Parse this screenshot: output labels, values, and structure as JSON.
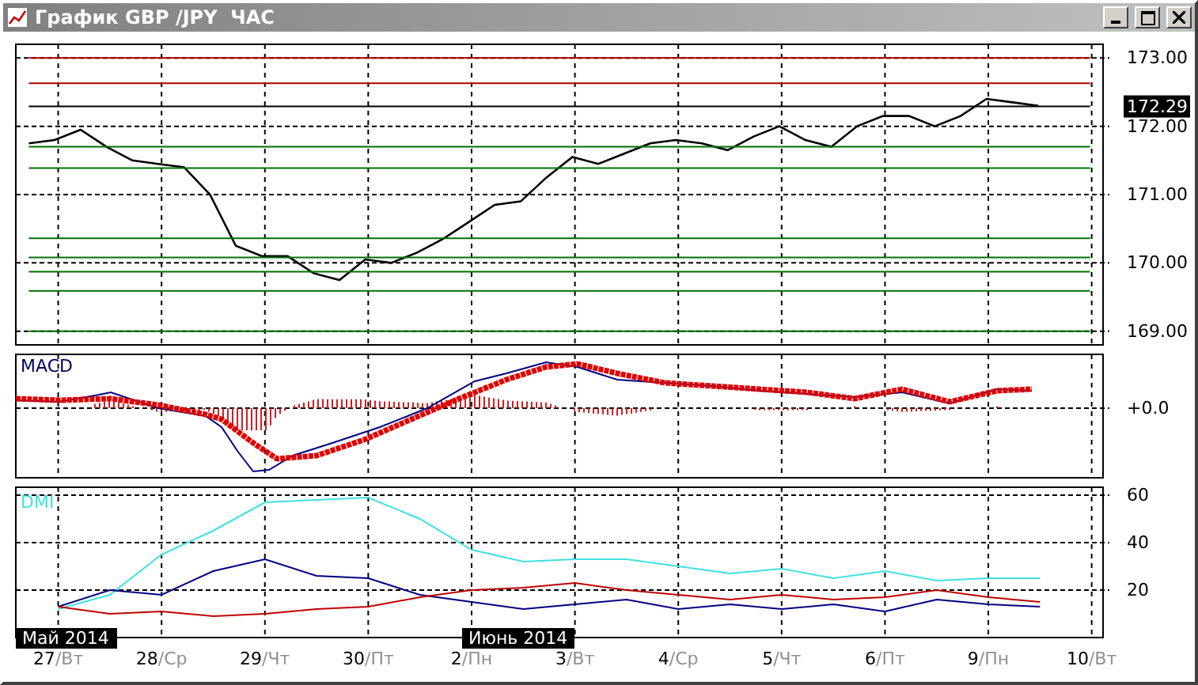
{
  "window": {
    "title": "График GBP /JPY  ЧАС",
    "buttons": [
      {
        "kind": "minimize"
      },
      {
        "kind": "maximize"
      },
      {
        "kind": "close"
      }
    ]
  },
  "price_panel": {
    "last_price": "172.29",
    "chart_data": {
      "type": "line",
      "categories": [
        null,
        null,
        null,
        null,
        null,
        null,
        null,
        null,
        null,
        null,
        null,
        null,
        null,
        null,
        null,
        null,
        null,
        null,
        null,
        null,
        null,
        null,
        null,
        null,
        null,
        null,
        null,
        null,
        null,
        null,
        null,
        null,
        null,
        null,
        null,
        null,
        null,
        null,
        null,
        null,
        null,
        null
      ],
      "series": [
        {
          "color": "#000000",
          "values": [
            171.75,
            171.8,
            171.95,
            171.7,
            171.5,
            171.45,
            171.4,
            171.0,
            170.25,
            170.1,
            170.1,
            169.85,
            169.75,
            170.05,
            170.0,
            170.15,
            170.35,
            170.6,
            170.85,
            170.9,
            171.25,
            171.55,
            171.45,
            171.6,
            171.75,
            171.8,
            171.75,
            171.65,
            171.85,
            172.0,
            171.8,
            171.7,
            172.0,
            172.15,
            172.15,
            172.0,
            172.15,
            172.4,
            172.35,
            172.3,
            null,
            null
          ]
        },
        {
          "color": "#b00000",
          "values": [
            173,
            173,
            173,
            173,
            173,
            173,
            173,
            173,
            173,
            173,
            173,
            173,
            173,
            173,
            173,
            173,
            173,
            173,
            173,
            173,
            173,
            173,
            173,
            173,
            173,
            173,
            173,
            173,
            173,
            173,
            173,
            173,
            173,
            173,
            173,
            173,
            173,
            173,
            173,
            173,
            173,
            173
          ]
        },
        {
          "color": "#b00000",
          "values": [
            172.63,
            172.63,
            172.63,
            172.63,
            172.63,
            172.63,
            172.63,
            172.63,
            172.63,
            172.63,
            172.63,
            172.63,
            172.63,
            172.63,
            172.63,
            172.63,
            172.63,
            172.63,
            172.63,
            172.63,
            172.63,
            172.63,
            172.63,
            172.63,
            172.63,
            172.63,
            172.63,
            172.63,
            172.63,
            172.63,
            172.63,
            172.63,
            172.63,
            172.63,
            172.63,
            172.63,
            172.63,
            172.63,
            172.63,
            172.63,
            172.63,
            172.63
          ]
        },
        {
          "color": "#000000",
          "values": [
            172.29,
            172.29,
            172.29,
            172.29,
            172.29,
            172.29,
            172.29,
            172.29,
            172.29,
            172.29,
            172.29,
            172.29,
            172.29,
            172.29,
            172.29,
            172.29,
            172.29,
            172.29,
            172.29,
            172.29,
            172.29,
            172.29,
            172.29,
            172.29,
            172.29,
            172.29,
            172.29,
            172.29,
            172.29,
            172.29,
            172.29,
            172.29,
            172.29,
            172.29,
            172.29,
            172.29,
            172.29,
            172.29,
            172.29,
            172.29,
            172.29,
            172.29
          ]
        },
        {
          "color": "#007000",
          "values": [
            171.7,
            171.7,
            171.7,
            171.7,
            171.7,
            171.7,
            171.7,
            171.7,
            171.7,
            171.7,
            171.7,
            171.7,
            171.7,
            171.7,
            171.7,
            171.7,
            171.7,
            171.7,
            171.7,
            171.7,
            171.7,
            171.7,
            171.7,
            171.7,
            171.7,
            171.7,
            171.7,
            171.7,
            171.7,
            171.7,
            171.7,
            171.7,
            171.7,
            171.7,
            171.7,
            171.7,
            171.7,
            171.7,
            171.7,
            171.7,
            171.7,
            171.7
          ]
        },
        {
          "color": "#007000",
          "values": [
            171.39,
            171.39,
            171.39,
            171.39,
            171.39,
            171.39,
            171.39,
            171.39,
            171.39,
            171.39,
            171.39,
            171.39,
            171.39,
            171.39,
            171.39,
            171.39,
            171.39,
            171.39,
            171.39,
            171.39,
            171.39,
            171.39,
            171.39,
            171.39,
            171.39,
            171.39,
            171.39,
            171.39,
            171.39,
            171.39,
            171.39,
            171.39,
            171.39,
            171.39,
            171.39,
            171.39,
            171.39,
            171.39,
            171.39,
            171.39,
            171.39,
            171.39
          ]
        },
        {
          "color": "#007000",
          "values": [
            170.36,
            170.36,
            170.36,
            170.36,
            170.36,
            170.36,
            170.36,
            170.36,
            170.36,
            170.36,
            170.36,
            170.36,
            170.36,
            170.36,
            170.36,
            170.36,
            170.36,
            170.36,
            170.36,
            170.36,
            170.36,
            170.36,
            170.36,
            170.36,
            170.36,
            170.36,
            170.36,
            170.36,
            170.36,
            170.36,
            170.36,
            170.36,
            170.36,
            170.36,
            170.36,
            170.36,
            170.36,
            170.36,
            170.36,
            170.36,
            170.36,
            170.36
          ]
        },
        {
          "color": "#007000",
          "values": [
            170.08,
            170.08,
            170.08,
            170.08,
            170.08,
            170.08,
            170.08,
            170.08,
            170.08,
            170.08,
            170.08,
            170.08,
            170.08,
            170.08,
            170.08,
            170.08,
            170.08,
            170.08,
            170.08,
            170.08,
            170.08,
            170.08,
            170.08,
            170.08,
            170.08,
            170.08,
            170.08,
            170.08,
            170.08,
            170.08,
            170.08,
            170.08,
            170.08,
            170.08,
            170.08,
            170.08,
            170.08,
            170.08,
            170.08,
            170.08,
            170.08,
            170.08
          ]
        },
        {
          "color": "#007000",
          "values": [
            169.87,
            169.87,
            169.87,
            169.87,
            169.87,
            169.87,
            169.87,
            169.87,
            169.87,
            169.87,
            169.87,
            169.87,
            169.87,
            169.87,
            169.87,
            169.87,
            169.87,
            169.87,
            169.87,
            169.87,
            169.87,
            169.87,
            169.87,
            169.87,
            169.87,
            169.87,
            169.87,
            169.87,
            169.87,
            169.87,
            169.87,
            169.87,
            169.87,
            169.87,
            169.87,
            169.87,
            169.87,
            169.87,
            169.87,
            169.87,
            169.87,
            169.87
          ]
        },
        {
          "color": "#007000",
          "values": [
            169.59,
            169.59,
            169.59,
            169.59,
            169.59,
            169.59,
            169.59,
            169.59,
            169.59,
            169.59,
            169.59,
            169.59,
            169.59,
            169.59,
            169.59,
            169.59,
            169.59,
            169.59,
            169.59,
            169.59,
            169.59,
            169.59,
            169.59,
            169.59,
            169.59,
            169.59,
            169.59,
            169.59,
            169.59,
            169.59,
            169.59,
            169.59,
            169.59,
            169.59,
            169.59,
            169.59,
            169.59,
            169.59,
            169.59,
            169.59,
            169.59,
            169.59
          ]
        },
        {
          "color": "#007000",
          "values": [
            169,
            169,
            169,
            169,
            169,
            169,
            169,
            169,
            169,
            169,
            169,
            169,
            169,
            169,
            169,
            169,
            169,
            169,
            169,
            169,
            169,
            169,
            169,
            169,
            169,
            169,
            169,
            169,
            169,
            169,
            169,
            169,
            169,
            169,
            169,
            169,
            169,
            169,
            169,
            169,
            169,
            169
          ]
        }
      ],
      "ylim": [
        168.8,
        173.2
      ],
      "yticks": [
        {
          "value": 169,
          "label": "169.00"
        },
        {
          "value": 170,
          "label": "170.00"
        },
        {
          "value": 171,
          "label": "171.00"
        },
        {
          "value": 172,
          "label": "172.00"
        },
        {
          "value": 173,
          "label": "173.00"
        }
      ],
      "grid": true
    }
  },
  "macd_panel": {
    "label": "MACD",
    "zero_tick": "+0.0"
  },
  "dmi_panel": {
    "label": "DMI",
    "chart_data": {
      "type": "line",
      "categories": [
        "27/Вт",
        null,
        "28/Ср",
        null,
        "29/Чт",
        null,
        "30/Пт",
        null,
        "2/Пн",
        null,
        "3/Вт",
        null,
        "4/Ср",
        null,
        "5/Чт",
        null,
        "6/Пт",
        null,
        "9/Пн",
        null,
        "10/Вт"
      ],
      "series": [
        {
          "color": "#40e0e0",
          "values": [
            12,
            18,
            35,
            45,
            57,
            58,
            59,
            50,
            37,
            32,
            33,
            33,
            30,
            27,
            29,
            25,
            28,
            24,
            25,
            25,
            null
          ]
        },
        {
          "color": "#000080",
          "values": [
            13,
            20,
            18,
            28,
            33,
            26,
            25,
            18,
            15,
            12,
            14,
            16,
            12,
            14,
            12,
            14,
            11,
            16,
            14,
            13,
            null
          ]
        },
        {
          "color": "#c00000",
          "values": [
            13,
            10,
            11,
            9,
            10,
            12,
            13,
            17,
            20,
            21,
            23,
            20,
            18,
            16,
            18,
            16,
            17,
            20,
            17,
            15,
            null
          ]
        }
      ],
      "ylim": [
        0,
        63.3
      ],
      "grid": true,
      "yticks": [
        {
          "value": 20,
          "label": "20"
        },
        {
          "value": 40,
          "label": "40"
        },
        {
          "value": 60,
          "label": "60"
        }
      ]
    }
  },
  "time_axis": {
    "months": [
      {
        "label": "Май 2014"
      },
      {
        "label": "Июнь 2014"
      }
    ]
  }
}
